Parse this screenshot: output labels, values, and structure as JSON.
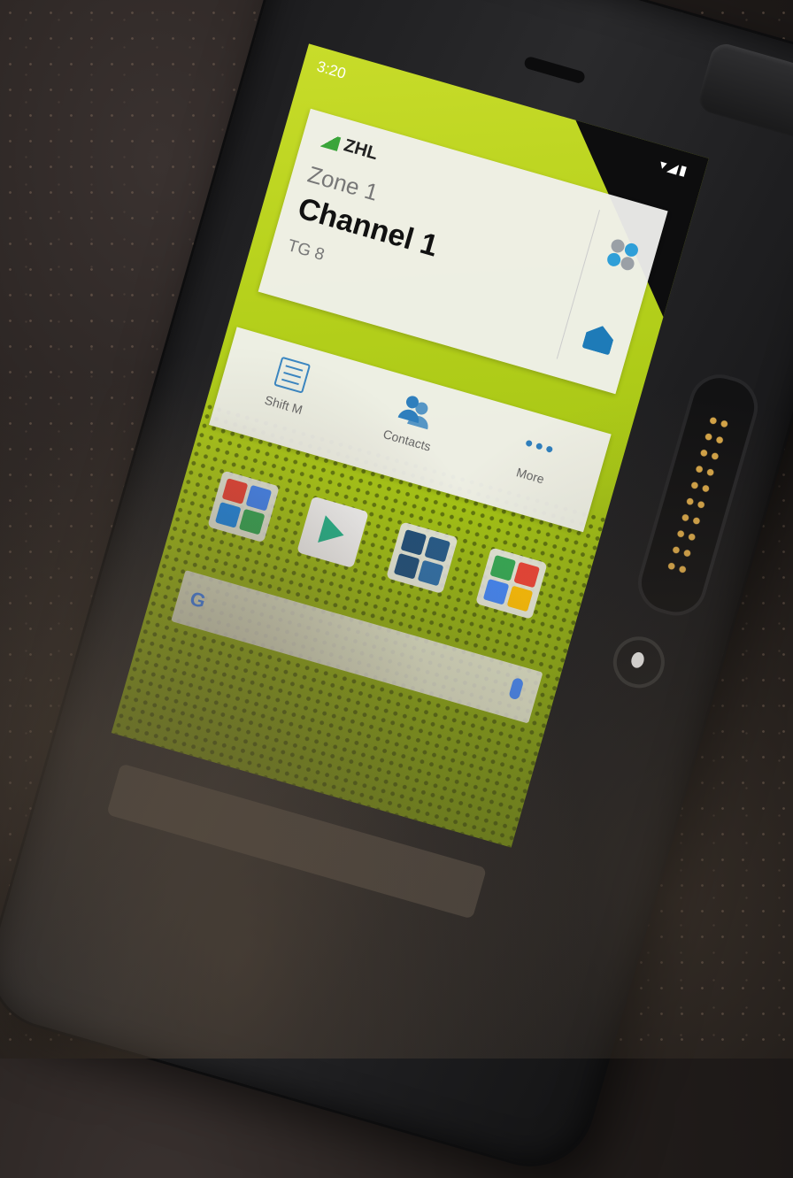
{
  "status_bar": {
    "time": "3:20",
    "icons": "▾◢▮"
  },
  "radio_widget": {
    "brand": "ZHL",
    "zone": "Zone 1",
    "channel": "Channel 1",
    "talkgroup": "TG 8"
  },
  "quick_actions": {
    "items": [
      {
        "label": "Shift M",
        "icon": "shift-menu-icon"
      },
      {
        "label": "Contacts",
        "icon": "contacts-icon"
      },
      {
        "label": "More",
        "icon": "more-dots-icon"
      }
    ]
  },
  "home_apps": [
    {
      "name": "google-apps-folder",
      "icon": "folder-icon"
    },
    {
      "name": "play-store",
      "icon": "play-store-icon"
    },
    {
      "name": "radio-apps-folder",
      "icon": "folder-icon"
    },
    {
      "name": "maps-folder",
      "icon": "folder-icon"
    }
  ],
  "search": {
    "logo": "G"
  },
  "colors": {
    "screen_accent": "#b6d11c",
    "icon_blue": "#2f7fbd",
    "connector_pins": "#d4a447"
  }
}
